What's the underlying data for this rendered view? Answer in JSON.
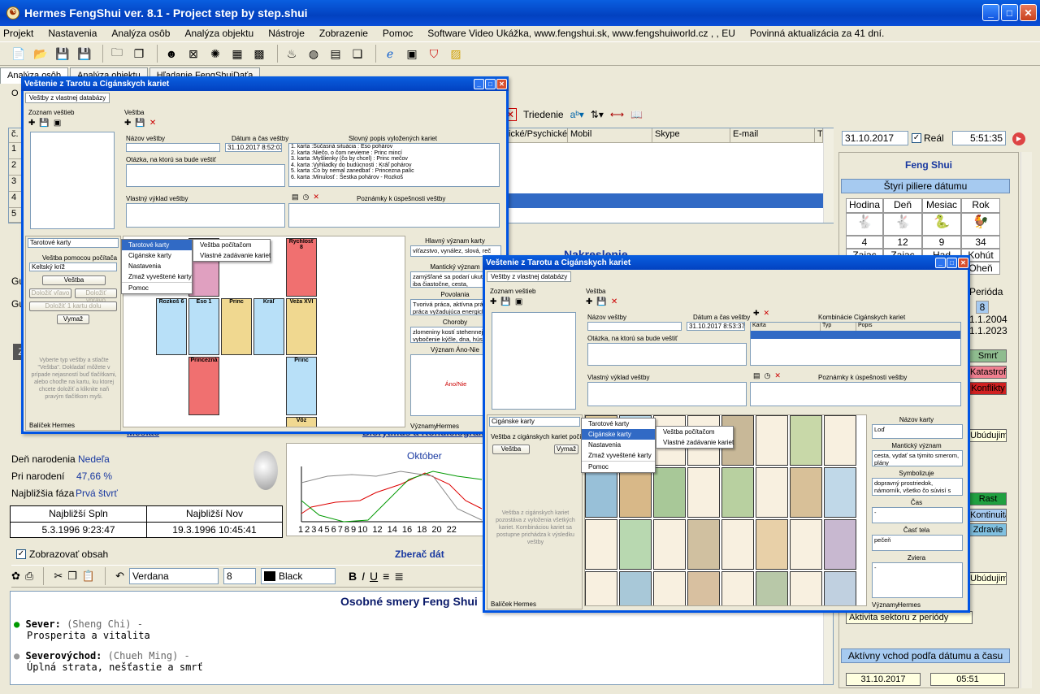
{
  "window": {
    "title": "Hermes FengShui ver. 8.1 - Project step by step.shui",
    "min": "_",
    "max": "□",
    "close": "✕"
  },
  "menu": [
    "Projekt",
    "Nastavenia",
    "Analýza osôb",
    "Analýza objektu",
    "Nástroje",
    "Zobrazenie",
    "Pomoc",
    "Software Video  Ukážka, www.fengshui.sk, www.fengshuiworld.cz ,  , EU",
    "Povinná aktualizácia za 41 dní."
  ],
  "tabs": [
    "Analýza osôb",
    "Analýza objektu",
    "Hľadanie FengShuiDaťa"
  ],
  "grid": {
    "label_o": "O",
    "toolbar_sort": "Triedenie",
    "cols": [
      "č.",
      "ické/Psychické",
      "Mobil",
      "Skype",
      "E-mail",
      "Te"
    ],
    "rows": [
      "1",
      "2",
      "3",
      "4",
      "5"
    ]
  },
  "date": {
    "value": "31.10.2017",
    "real": "Reál",
    "time": "5:51:35"
  },
  "fengshui": {
    "title": "Feng Shui",
    "pillars": "Štyri piliere dátumu",
    "heads": [
      "Hodina",
      "Deň",
      "Mesiac",
      "Rok"
    ],
    "nums": [
      "4",
      "12",
      "9",
      "34"
    ],
    "animals": [
      "Zajac",
      "Zajac",
      "Had",
      "Kohút"
    ],
    "extra": "Oheň",
    "perioda": "Perióda",
    "per_val": "8",
    "y1": "1.1.2004",
    "y2": "1.1.2023"
  },
  "colors": {
    "smrt": "Smrť",
    "katastrofa": "Katastrofa",
    "konflikty": "Konflikty",
    "ubudujima": "Ubúdujima",
    "rast": "Rast",
    "kontinuita": "Kontinuita",
    "zdravie": "Zdravie",
    "ubudujima2": "Ubúdujima",
    "aktivita": "Aktivita sektoru z periódy",
    "aktivny": "Aktívny vchod podľa dátumu a času",
    "bot_date": "31.10.2017",
    "bot_time": "05:51"
  },
  "moon": {
    "born_day_label": "Deň narodenia",
    "born_day": "Nedeľa",
    "pri_label": "Pri narodení",
    "pri": "47,66 %",
    "faza_label": "Najbližšia fáza",
    "faza": "Prvá štvrť",
    "spln_h": "Najbližší Spln",
    "nov_h": "Najbližší Nov",
    "spln": "5.3.1996 9:23:47",
    "nov": "19.3.1996 10:45:41",
    "mesiac_link": "Mesiac",
    "bio_link": "Biorytmus a Kondiciogram"
  },
  "chart": {
    "month": "Október",
    "ticks": [
      "1",
      "2",
      "3",
      "4",
      "5",
      "6",
      "7",
      "8",
      "9",
      "10",
      "12",
      "14",
      "16",
      "18",
      "20",
      "22"
    ]
  },
  "content": {
    "show": "Zobrazovať obsah",
    "zberac": "Zberač dát",
    "font": "Verdana",
    "size": "8",
    "color": "Black",
    "heading": "Osobné smery Feng Shui",
    "s1": "Sever:",
    "s1b": "(Sheng Chi) -",
    "s1c": "Prosperita a vitalita",
    "s2": "Severovýchod:",
    "s2b": "(Chueh Ming) -",
    "s2c": "Úplná strata, nešťastie a smrť"
  },
  "left": {
    "gu1": "Gu",
    "gu2": "Gu",
    "z": "Z",
    "nakres": "Nakreslenie"
  },
  "dlg1": {
    "title": "Veštenie z Tarotu a Cigánskych kariet",
    "tab": "Veštby z vlastnej databázy",
    "zoznam": "Zoznam veštieb",
    "vestba": "Veštba",
    "nazov": "Názov veštby",
    "datum": "Dátum a čas veštby",
    "datum_val": "31.10.2017 8:52:03",
    "slovny": "Slovný popis vyložených kariet",
    "popis": [
      "1. karta :Súčasná situácia : Eso pohárov",
      "2. karta :Niečo, o čom nevieme : Princ mincí",
      "3. karta :Myšlienky (čo by chcel) : Princ mečov",
      "4. karta :Vyhliadky do budúcnosti : Kráľ pohárov",
      "5. karta :Čo by nemal zanedbať : Princezna palíc",
      "6. karta :Minulosť : Šestka pohárov - Rozkoš"
    ],
    "otazka": "Otázka, na ktorú sa bude veštiť",
    "vyklad": "Vlastný výklad veštby",
    "poznamky": "Poznámky k úspešnosti veštby",
    "karty_sel": "Tarotové karty",
    "vestba_poc": "Veštba pomocou počítača",
    "kriz": "Keltský kríž",
    "b_vestba": "Veštba",
    "b_vlavo": "Doložiť vľavo",
    "b_vpravo": "Doložiť vpravo",
    "b_dolu": "Doložiť 1 kartu dolu",
    "b_vymaz": "Vymaž",
    "hint": "Vyberte typ veštby a stlačte \"Veštba\". Dokladať môžete v prípade nejasností buď tlačítkami, alebo choďte na kartu, ku ktorej chcete doložiť a kliknite naň pravým tlačítkom myši.",
    "bal": "Balíček",
    "hermes": "Hermes",
    "menu": [
      "Tarotové karty",
      "Cigánske karty",
      "Nastavenia",
      "Zmaž vyveštené karty",
      "Pomoc"
    ],
    "sub": [
      "Veštba počítačom",
      "Vlastné zadávanie kariet"
    ],
    "cards": [
      "Rychlosť 8",
      "Rozkoš 6",
      "Eso 1",
      "Princ",
      "Kráľ",
      "Veža XVI",
      "Princezná",
      "Princ",
      "Vôz"
    ],
    "hv": "Hlavný význam karty",
    "hv_t": "víťazstvo, vynález, slová, reč",
    "mv": "Mantický význam",
    "mv_t": "zamýšľané sa podarí ukutočniť, iba čiastočne, cesta, pohyblivosť",
    "pov": "Povolania",
    "pov_t": "Tvorivá práca, aktívna práca, práca vyžadujúca energickosť",
    "ch": "Choroby",
    "ch_t": "zlomeniny kostí stehennej, vybočenie kýčle, dna, húser",
    "an": "Význam Áno-Nie",
    "an_t": "Áno/Nie",
    "vyz": "Významy"
  },
  "dlg2": {
    "title": "Veštenie z Tarotu a Cigánskych kariet",
    "tab": "Veštby z vlastnej databázy",
    "zoznam": "Zoznam veštieb",
    "vestba": "Veštba",
    "nazov": "Názov veštby",
    "datum": "Dátum a čas veštby",
    "datum_val": "31.10.2017 8:53:37",
    "komb": "Kombinácie Cigánskych kariet",
    "k_cols": [
      "Karta",
      "Typ",
      "Popis"
    ],
    "otazka": "Otázka, na ktorú sa bude veštiť",
    "vyklad": "Vlastný výklad veštby",
    "poznamky": "Poznámky k úspešnosti veštby",
    "karty_sel": "Cigánske karty",
    "vestba_poc": "Veštba z cigánskych kariet počítačom",
    "b_vestba": "Veštba",
    "b_vymaz": "Vymaž",
    "hint": "Veštba z cigánskych kariet pozostáva z vyloženia všetkých kariet. Kombináciou kariet sa postupne prichádza k výsledku veštby",
    "bal": "Balíček",
    "hermes": "Hermes",
    "menu": [
      "Tarotové karty",
      "Cigánske karty",
      "Nastavenia",
      "Zmaž vyveštené karty",
      "Pomoc"
    ],
    "sub": [
      "Veštba počítačom",
      "Vlastné zadávanie kariet"
    ],
    "nk": "Názov karty",
    "nk_t": "Loď",
    "mv": "Mantický význam",
    "mv_t": "cesta, vydať sa týmito smerom, plány",
    "sym": "Symbolizuje",
    "sym_t": "dopravný prostriedok, námorník, všetko čo súvisí s cestovaním",
    "cas": "Čas",
    "cas_t": "-",
    "ct": "Časť tela",
    "ct_t": "pečeň",
    "zv": "Zviera",
    "zv_t": "-",
    "vyz": "Významy"
  }
}
